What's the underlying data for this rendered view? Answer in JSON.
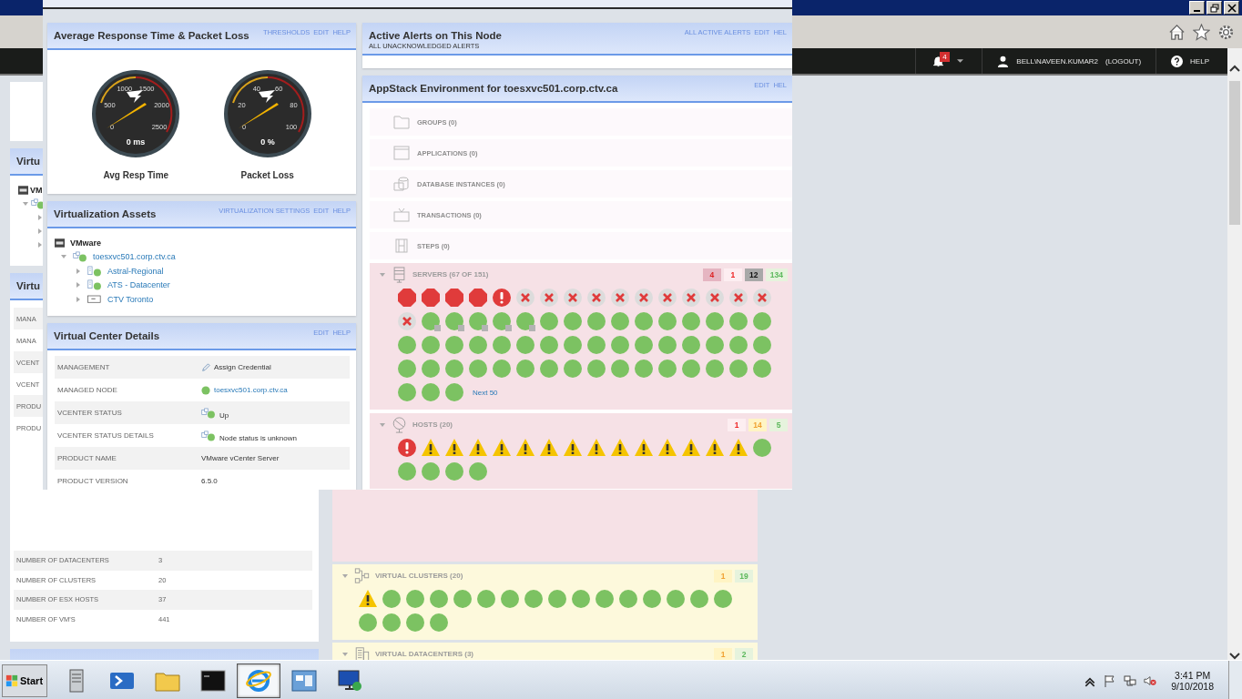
{
  "nav": {
    "alerts_count": "4",
    "user": "BELL\\NAVEEN.KUMAR2",
    "logout": "(LOGOUT)",
    "help": "HELP"
  },
  "page_behind": {
    "left": [
      {
        "kind": "blank"
      },
      {
        "kind": "tree",
        "title": "Virtu",
        "tree": [
          {
            "label": "VM",
            "children": [
              {
                "expanded": true,
                "children": [
                  {
                    "expanded": false
                  },
                  {
                    "expanded": false
                  },
                  {
                    "expanded": false
                  }
                ]
              }
            ]
          }
        ]
      },
      {
        "kind": "details",
        "title": "Virtu",
        "rows": [
          {
            "label": "MANA"
          },
          {
            "label": "MANA"
          },
          {
            "label": "VCENT"
          },
          {
            "label": "VCENT"
          },
          {
            "label": "PRODU"
          },
          {
            "label": "PRODU"
          }
        ],
        "totals": [
          {
            "label": "NUMBER OF DATACENTERS",
            "value": "3"
          },
          {
            "label": "NUMBER OF CLUSTERS",
            "value": "20"
          },
          {
            "label": "NUMBER OF ESX HOSTS",
            "value": "37"
          },
          {
            "label": "NUMBER OF VM'S",
            "value": "441"
          }
        ]
      },
      {
        "kind": "blank"
      }
    ],
    "sections": [
      {
        "color": "#f6e1e6"
      },
      {
        "kind": "clusters",
        "color": "#fdf9dc",
        "title": "VIRTUAL CLUSTERS (20)",
        "expanded": true,
        "counts": [
          {
            "kind": "warning",
            "text": "1"
          },
          {
            "kind": "up",
            "text": "19"
          }
        ],
        "items": [
          {
            "kind": "warning"
          },
          {
            "kind": "up"
          },
          {
            "kind": "up"
          },
          {
            "kind": "up"
          },
          {
            "kind": "up"
          },
          {
            "kind": "up"
          },
          {
            "kind": "up"
          },
          {
            "kind": "up"
          },
          {
            "kind": "up"
          },
          {
            "kind": "up"
          },
          {
            "kind": "up"
          },
          {
            "kind": "up"
          },
          {
            "kind": "up"
          },
          {
            "kind": "up"
          },
          {
            "kind": "up"
          },
          {
            "kind": "up"
          },
          {
            "kind": "up"
          },
          {
            "kind": "up"
          },
          {
            "kind": "up"
          },
          {
            "kind": "up"
          }
        ]
      },
      {
        "kind": "datacenters",
        "color": "#fdf9dc",
        "title": "VIRTUAL DATACENTERS (3)",
        "expanded": true,
        "counts": [
          {
            "kind": "warning",
            "text": "1"
          },
          {
            "kind": "up",
            "text": "2"
          }
        ]
      }
    ]
  },
  "overlay": {
    "left": [
      {
        "kind": "gauges",
        "title": "Average Response Time & Packet Loss",
        "links": [
          "THRESHOLDS",
          "EDIT",
          "HELP"
        ],
        "gauges": [
          {
            "ticks": [
              "0",
              "500",
              "1000",
              "1500",
              "2000",
              "2500"
            ],
            "reading": "0 ms",
            "label": "Avg Resp Time"
          },
          {
            "ticks": [
              "0",
              "20",
              "40",
              "60",
              "80",
              "100"
            ],
            "reading": "0 %",
            "label": "Packet Loss"
          }
        ]
      },
      {
        "kind": "tree",
        "title": "Virtualization Assets",
        "links": [
          "VIRTUALIZATION SETTINGS",
          "EDIT",
          "HELP"
        ],
        "tree": [
          {
            "kind": "vendor",
            "label": "VMware",
            "children": [
              {
                "kind": "vcenter",
                "label": "toesxvc501.corp.ctv.ca",
                "expanded": true,
                "children": [
                  {
                    "kind": "datacenter",
                    "label": "Astral-Regional",
                    "expanded": false
                  },
                  {
                    "kind": "datacenter",
                    "label": "ATS - Datacenter",
                    "expanded": false
                  },
                  {
                    "kind": "folder",
                    "label": "CTV Toronto",
                    "expanded": false
                  }
                ]
              }
            ]
          }
        ]
      },
      {
        "kind": "details",
        "title": "Virtual Center Details",
        "links": [
          "EDIT",
          "HELP"
        ],
        "rows": [
          {
            "kind": "pencil",
            "label": "MANAGEMENT",
            "value": "Assign Credential"
          },
          {
            "kind": "node",
            "label": "MANAGED NODE",
            "value": "toesxvc501.corp.ctv.ca"
          },
          {
            "kind": "status",
            "label": "VCENTER STATUS",
            "value": "Up"
          },
          {
            "kind": "status",
            "label": "VCENTER STATUS DETAILS",
            "value": "Node status is unknown"
          },
          {
            "kind": "plain",
            "label": "PRODUCT NAME",
            "value": "VMware vCenter Server"
          },
          {
            "kind": "plain",
            "label": "PRODUCT VERSION",
            "value": "6.5.0"
          }
        ]
      }
    ],
    "right": [
      {
        "kind": "alerts",
        "title": "Active Alerts on This Node",
        "subtitle": "ALL UNACKNOWLEDGED ALERTS",
        "links": [
          "ALL ACTIVE ALERTS",
          "EDIT",
          "HEL"
        ]
      },
      {
        "kind": "appstack",
        "title": "AppStack Environment for toesxvc501.corp.ctv.ca",
        "links": [
          "EDIT",
          "HEL"
        ],
        "empty": [
          {
            "kind": "groups",
            "label": "GROUPS (0)"
          },
          {
            "kind": "applications",
            "label": "APPLICATIONS (0)"
          },
          {
            "kind": "databases",
            "label": "DATABASE INSTANCES (0)"
          },
          {
            "kind": "transactions",
            "label": "TRANSACTIONS (0)"
          },
          {
            "kind": "steps",
            "label": "STEPS (0)"
          }
        ],
        "sections": [
          {
            "kind": "servers",
            "color": "#f6e1e6",
            "title": "SERVERS (67 OF 151)",
            "expanded": true,
            "more": "Next 50",
            "counts": [
              {
                "kind": "down",
                "text": "4"
              },
              {
                "kind": "critical",
                "text": "1"
              },
              {
                "kind": "unknown",
                "text": "12"
              },
              {
                "kind": "up",
                "text": "134"
              }
            ],
            "items": [
              {
                "kind": "down"
              },
              {
                "kind": "down"
              },
              {
                "kind": "down"
              },
              {
                "kind": "down"
              },
              {
                "kind": "critical"
              },
              {
                "kind": "unknown"
              },
              {
                "kind": "unknown"
              },
              {
                "kind": "unknown"
              },
              {
                "kind": "unknown"
              },
              {
                "kind": "unknown"
              },
              {
                "kind": "unknown"
              },
              {
                "kind": "unknown"
              },
              {
                "kind": "unknown"
              },
              {
                "kind": "unknown"
              },
              {
                "kind": "unknown"
              },
              {
                "kind": "unknown"
              },
              {
                "kind": "unknown"
              },
              {
                "kind": "unmanaged"
              },
              {
                "kind": "unmanaged"
              },
              {
                "kind": "unmanaged"
              },
              {
                "kind": "unmanaged"
              },
              {
                "kind": "unmanaged"
              },
              {
                "kind": "up"
              },
              {
                "kind": "up"
              },
              {
                "kind": "up"
              },
              {
                "kind": "up"
              },
              {
                "kind": "up"
              },
              {
                "kind": "up"
              },
              {
                "kind": "up"
              },
              {
                "kind": "up"
              },
              {
                "kind": "up"
              },
              {
                "kind": "up"
              },
              {
                "kind": "up"
              },
              {
                "kind": "up"
              },
              {
                "kind": "up"
              },
              {
                "kind": "up"
              },
              {
                "kind": "up"
              },
              {
                "kind": "up"
              },
              {
                "kind": "up"
              },
              {
                "kind": "up"
              },
              {
                "kind": "up"
              },
              {
                "kind": "up"
              },
              {
                "kind": "up"
              },
              {
                "kind": "up"
              },
              {
                "kind": "up"
              },
              {
                "kind": "up"
              },
              {
                "kind": "up"
              },
              {
                "kind": "up"
              },
              {
                "kind": "up"
              },
              {
                "kind": "up"
              },
              {
                "kind": "up"
              },
              {
                "kind": "up"
              },
              {
                "kind": "up"
              },
              {
                "kind": "up"
              },
              {
                "kind": "up"
              },
              {
                "kind": "up"
              },
              {
                "kind": "up"
              },
              {
                "kind": "up"
              },
              {
                "kind": "up"
              },
              {
                "kind": "up"
              },
              {
                "kind": "up"
              },
              {
                "kind": "up"
              },
              {
                "kind": "up"
              },
              {
                "kind": "up"
              },
              {
                "kind": "up"
              },
              {
                "kind": "up"
              },
              {
                "kind": "up"
              }
            ]
          },
          {
            "kind": "hosts",
            "color": "#f6e1e6",
            "title": "HOSTS (20)",
            "expanded": true,
            "counts": [
              {
                "kind": "critical",
                "text": "1"
              },
              {
                "kind": "warning",
                "text": "14"
              },
              {
                "kind": "up",
                "text": "5"
              }
            ],
            "items": [
              {
                "kind": "critical"
              },
              {
                "kind": "warning"
              },
              {
                "kind": "warning"
              },
              {
                "kind": "warning"
              },
              {
                "kind": "warning"
              },
              {
                "kind": "warning"
              },
              {
                "kind": "warning"
              },
              {
                "kind": "warning"
              },
              {
                "kind": "warning"
              },
              {
                "kind": "warning"
              },
              {
                "kind": "warning"
              },
              {
                "kind": "warning"
              },
              {
                "kind": "warning"
              },
              {
                "kind": "warning"
              },
              {
                "kind": "warning"
              },
              {
                "kind": "up"
              },
              {
                "kind": "up"
              },
              {
                "kind": "up"
              },
              {
                "kind": "up"
              },
              {
                "kind": "up"
              }
            ]
          }
        ]
      }
    ]
  },
  "taskbar": {
    "start": "Start",
    "apps": [
      {
        "kind": "server",
        "selected": false
      },
      {
        "kind": "shell",
        "selected": false
      },
      {
        "kind": "folder",
        "selected": false
      },
      {
        "kind": "console",
        "selected": false
      },
      {
        "kind": "browser",
        "selected": true
      },
      {
        "kind": "dashboard",
        "selected": false
      },
      {
        "kind": "remote",
        "selected": false
      }
    ],
    "time": "3:41 PM",
    "date": "9/10/2018"
  }
}
